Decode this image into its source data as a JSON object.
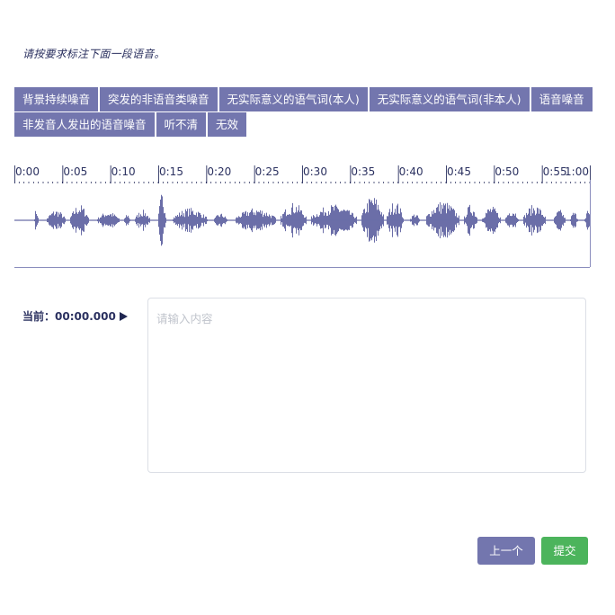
{
  "instruction": "请按要求标注下面一段语音。",
  "tags_row1": [
    "背景持续噪音",
    "突发的非语音类噪音",
    "无实际意义的语气词(本人)",
    "无实际意义的语气词(非本人)",
    "语音噪音"
  ],
  "tags_row2": [
    "非发音人发出的语音噪音",
    "听不清",
    "无效"
  ],
  "timeline": {
    "labels": [
      "0:00",
      "0:05",
      "0:10",
      "0:15",
      "0:20",
      "0:25",
      "0:30",
      "0:35",
      "0:40",
      "0:45",
      "0:50",
      "0:55",
      "1:00"
    ]
  },
  "player": {
    "current_label": "当前：",
    "current_time": "00:00.000",
    "play_icon": "play-icon"
  },
  "input": {
    "placeholder": "请输入内容",
    "value": ""
  },
  "buttons": {
    "prev_label": "上一个",
    "submit_label": "提交"
  },
  "colors": {
    "accent": "#7376ae",
    "waveform": "#6b6ea8",
    "submit": "#4cb45c",
    "text_dark": "#2b3160"
  }
}
